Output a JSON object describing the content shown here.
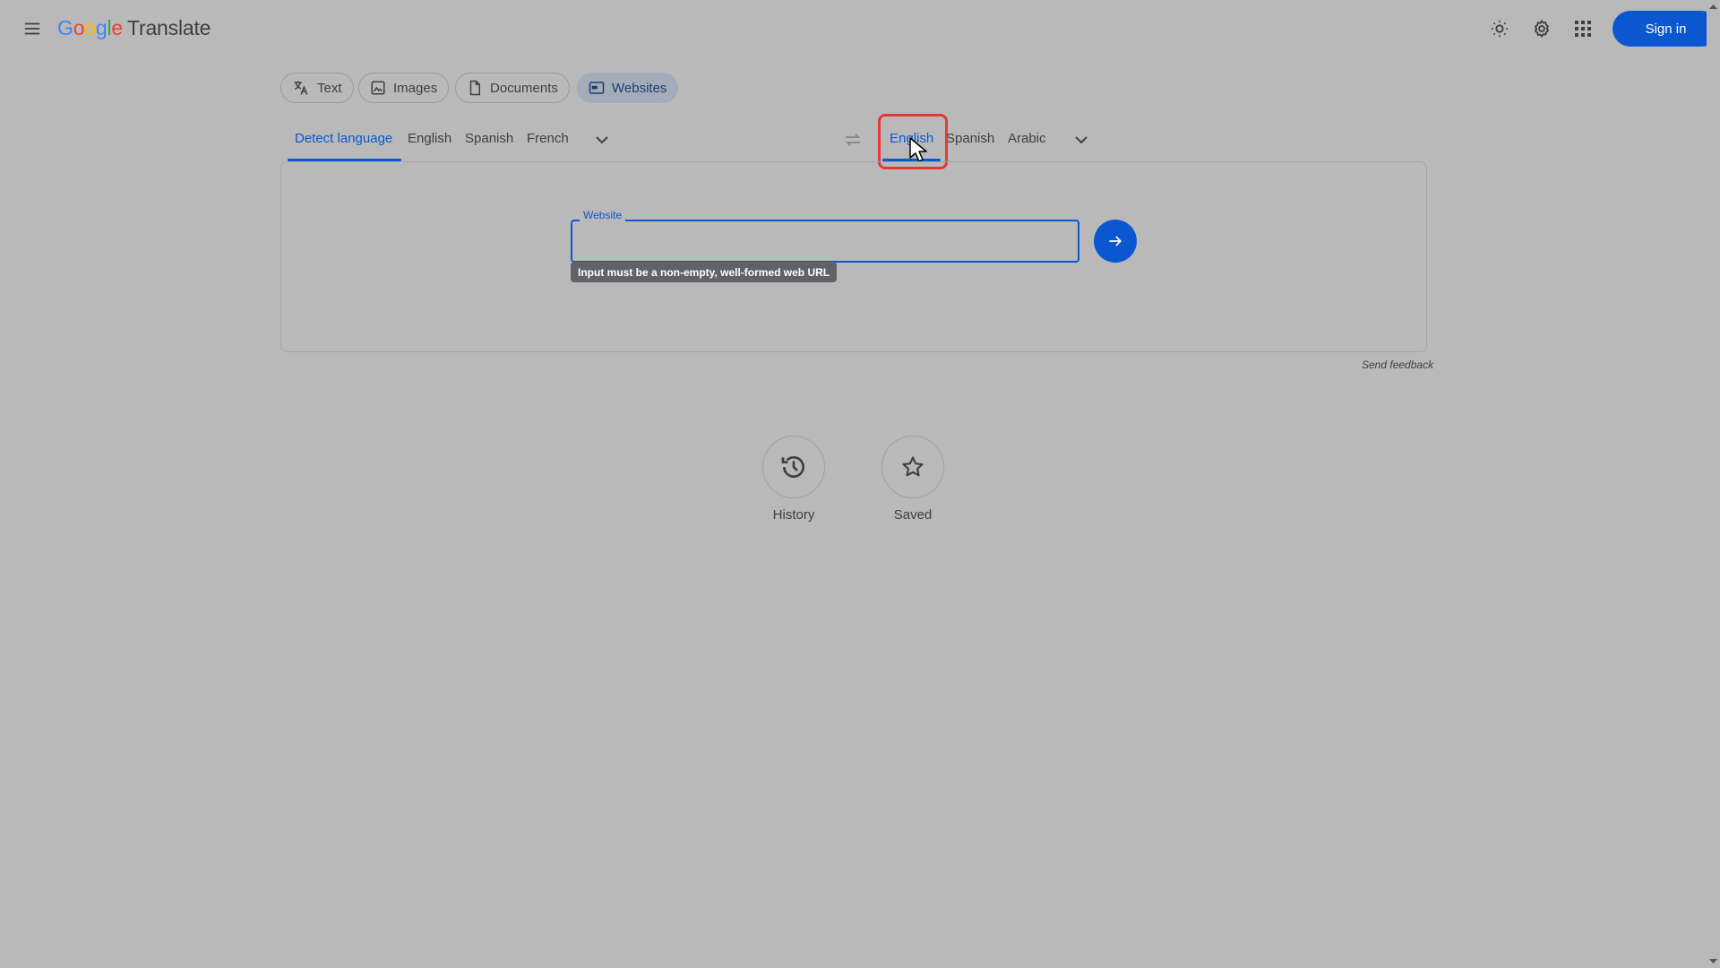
{
  "header": {
    "logo_google": [
      "G",
      "o",
      "o",
      "g",
      "l",
      "e"
    ],
    "logo_translate": "Translate",
    "sign_in": "Sign in",
    "icons": [
      "menu-icon",
      "theme-icon",
      "settings-icon",
      "apps-icon"
    ]
  },
  "mode_tabs": [
    {
      "label": "Text",
      "icon": "translate-icon"
    },
    {
      "label": "Images",
      "icon": "image-icon"
    },
    {
      "label": "Documents",
      "icon": "document-icon"
    },
    {
      "label": "Websites",
      "icon": "website-icon",
      "active": true
    }
  ],
  "source_languages": [
    "Detect language",
    "English",
    "Spanish",
    "French"
  ],
  "target_languages": [
    "English",
    "Spanish",
    "Arabic"
  ],
  "website_input": {
    "label": "Website",
    "value": "",
    "error_tooltip": "Input must be a non-empty, well-formed web URL"
  },
  "send_feedback": "Send feedback",
  "bottom_actions": [
    {
      "label": "History",
      "icon": "history-icon"
    },
    {
      "label": "Saved",
      "icon": "star-icon"
    }
  ],
  "colors": {
    "accent": "#0b57d0",
    "background": "#b9b9b9",
    "highlight": "#e53935"
  }
}
